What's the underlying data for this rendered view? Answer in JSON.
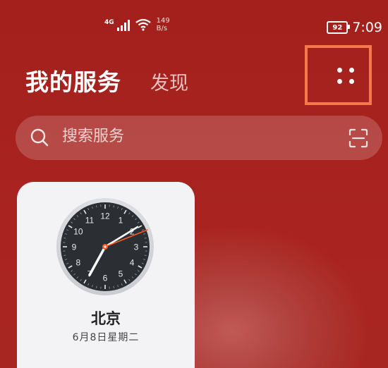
{
  "status_bar": {
    "network": "4G",
    "speed_value": "149",
    "speed_unit": "B/s",
    "battery": "92",
    "time": "7:09"
  },
  "header": {
    "title": "我的服务",
    "discover_tab": "发现",
    "menu_icon": "four-dots-icon"
  },
  "search": {
    "placeholder": "搜索服务",
    "icons": [
      "search-icon",
      "scan-icon"
    ]
  },
  "clock_widget": {
    "city": "北京",
    "date": "6月8日星期二",
    "dial_numbers": [
      "12",
      "1",
      "2",
      "3",
      "4",
      "5",
      "6",
      "7",
      "8",
      "9",
      "10",
      "11"
    ],
    "accent_color": "#ff5a1f"
  }
}
